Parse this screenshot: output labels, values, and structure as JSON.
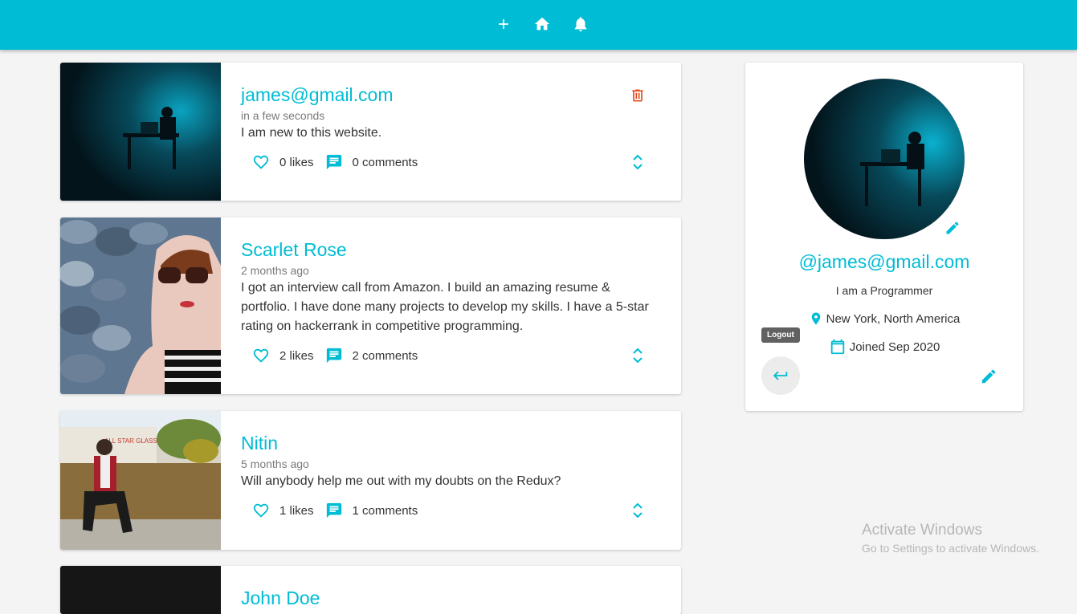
{
  "topbar": {
    "bg": "#00bcd4",
    "icons": [
      "plus-icon",
      "home-icon",
      "bell-icon"
    ]
  },
  "colors": {
    "accent": "#00bcd4",
    "delete": "#e64a19",
    "text": "#333333",
    "muted": "#7a7a7a"
  },
  "posts": [
    {
      "author": "james@gmail.com",
      "time": "in a few seconds",
      "text": "I am new to this website.",
      "likes": "0 likes",
      "comments": "0 comments",
      "can_delete": true
    },
    {
      "author": "Scarlet Rose",
      "time": "2 months ago",
      "text": "I got an interview call from Amazon. I build an amazing resume & portfolio. I have done many projects to develop my skills. I have a 5-star rating on hackerrank in competitive programming.",
      "likes": "2 likes",
      "comments": "2 comments"
    },
    {
      "author": "Nitin",
      "time": "5 months ago",
      "text": "Will anybody help me out with my doubts on the Redux?",
      "likes": "1 likes",
      "comments": "1 comments"
    },
    {
      "author": "John Doe",
      "time": "",
      "text": "",
      "likes": "",
      "comments": ""
    }
  ],
  "profile": {
    "handle": "@james@gmail.com",
    "bio": "I am a Programmer",
    "location": "New York, North America",
    "joined": "Joined Sep 2020",
    "logout_tooltip": "Logout"
  },
  "watermark": {
    "line1": "Activate Windows",
    "line2": "Go to Settings to activate Windows."
  }
}
